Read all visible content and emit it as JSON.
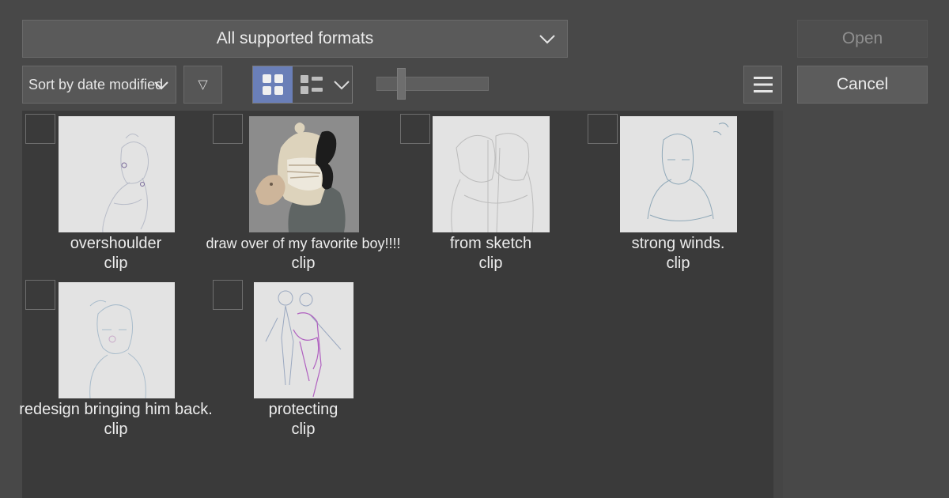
{
  "toolbar": {
    "format_select": "All supported formats",
    "sort_select": "Sort by date modified",
    "open_label": "Open",
    "cancel_label": "Cancel",
    "filter_glyph": "▽",
    "thumbnail_size": 0.2
  },
  "files": [
    {
      "name": "overshoulder",
      "ext": "clip",
      "thumb": "sketch"
    },
    {
      "name": "draw over of my favorite boy!!!!",
      "ext": "clip",
      "thumb": "color"
    },
    {
      "name": "from sketch",
      "ext": "clip",
      "thumb": "sketch"
    },
    {
      "name": "strong winds.",
      "ext": "clip",
      "thumb": "sketch"
    },
    {
      "name": "redesign bringing him back.",
      "ext": "clip",
      "thumb": "sketch"
    },
    {
      "name": "protecting",
      "ext": "clip",
      "thumb": "sketch"
    }
  ],
  "colors": {
    "background": "#484848",
    "file_area": "#3a3a3a",
    "view_active": "#6a7fb8",
    "thumb_bg": "#e3e3e3"
  }
}
